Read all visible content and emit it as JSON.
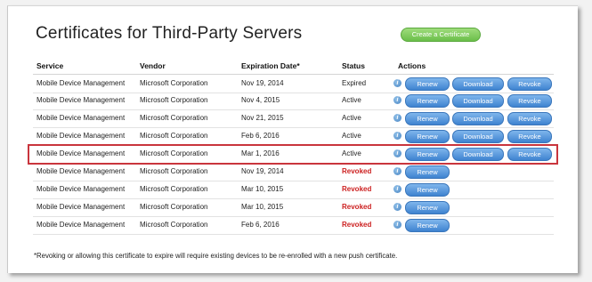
{
  "page": {
    "title": "Certificates for Third-Party Servers",
    "create_button": "Create a Certificate",
    "footnote": "*Revoking or allowing this certificate to expire will require existing devices to be re-enrolled with a new push certificate."
  },
  "table": {
    "headers": {
      "service": "Service",
      "vendor": "Vendor",
      "expiration": "Expiration Date*",
      "status": "Status",
      "actions": "Actions"
    },
    "buttons": {
      "renew": "Renew",
      "download": "Download",
      "revoke": "Revoke"
    },
    "info_glyph": "i",
    "rows": [
      {
        "service": "Mobile Device Management",
        "vendor": "Microsoft Corporation",
        "expiration": "Nov 19, 2014",
        "status": "Expired"
      },
      {
        "service": "Mobile Device Management",
        "vendor": "Microsoft Corporation",
        "expiration": "Nov 4, 2015",
        "status": "Active"
      },
      {
        "service": "Mobile Device Management",
        "vendor": "Microsoft Corporation",
        "expiration": "Nov 21, 2015",
        "status": "Active"
      },
      {
        "service": "Mobile Device Management",
        "vendor": "Microsoft Corporation",
        "expiration": "Feb 6, 2016",
        "status": "Active"
      },
      {
        "service": "Mobile Device Management",
        "vendor": "Microsoft Corporation",
        "expiration": "Mar 1, 2016",
        "status": "Active"
      },
      {
        "service": "Mobile Device Management",
        "vendor": "Microsoft Corporation",
        "expiration": "Nov 19, 2014",
        "status": "Revoked"
      },
      {
        "service": "Mobile Device Management",
        "vendor": "Microsoft Corporation",
        "expiration": "Mar 10, 2015",
        "status": "Revoked"
      },
      {
        "service": "Mobile Device Management",
        "vendor": "Microsoft Corporation",
        "expiration": "Mar 10, 2015",
        "status": "Revoked"
      },
      {
        "service": "Mobile Device Management",
        "vendor": "Microsoft Corporation",
        "expiration": "Feb 6, 2016",
        "status": "Revoked"
      }
    ]
  },
  "colors": {
    "create_button": "#6bbf4a",
    "action_button": "#3f83d0",
    "revoked_text": "#cc1f1f",
    "highlight_border": "#c9353d"
  },
  "icons": {
    "info": "info-icon"
  }
}
